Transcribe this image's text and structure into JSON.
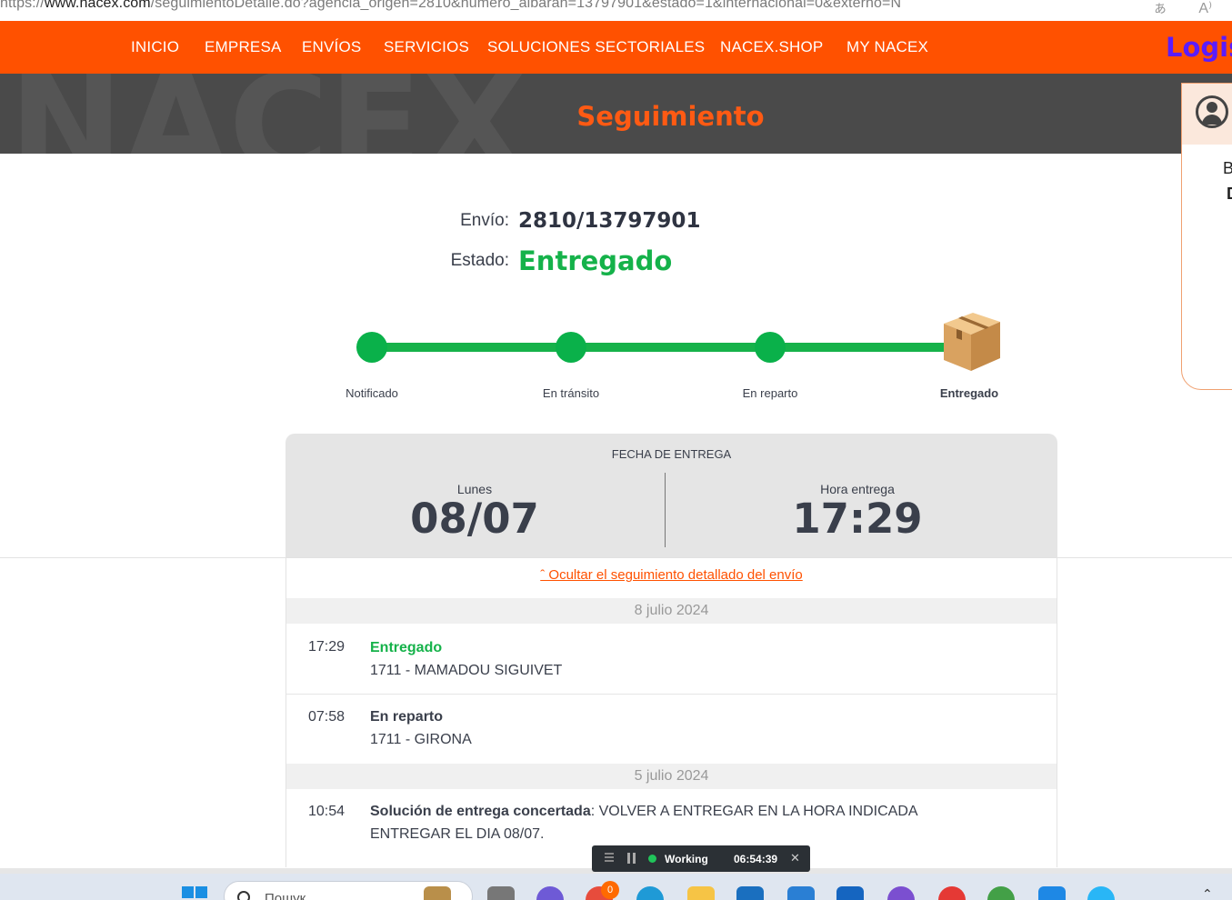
{
  "browser": {
    "url_prefix": "https://",
    "url_domain": "www.nacex.com",
    "url_path": "/seguimientoDetalle.do?agencia_origen=2810&numero_albaran=13797901&estado=1&internacional=0&externo=N",
    "icons": [
      "translate-icon",
      "read-aloud-icon"
    ],
    "icon_glyph_1": "ぁ",
    "icon_glyph_2": "A⁾"
  },
  "nav": {
    "items": [
      "INICIO",
      "EMPRESA",
      "ENVÍOS",
      "SERVICIOS",
      "SOLUCIONES SECTORIALES",
      "NACEX.SHOP",
      "MY NACEX"
    ],
    "logo": "Logis",
    "color": "#ff5100"
  },
  "hero": {
    "title": "Seguimiento"
  },
  "sidebox": {
    "line1": "B",
    "line2": "D"
  },
  "shipment": {
    "envio_label": "Envío:",
    "envio_value": "2810/13797901",
    "estado_label": "Estado:",
    "estado_value": "Entregado",
    "status_color": "#15b24a"
  },
  "progress": {
    "steps": [
      "Notificado",
      "En tránsito",
      "En reparto",
      "Entregado"
    ],
    "completed_steps": 4
  },
  "delivery": {
    "heading": "FECHA DE ENTREGA",
    "day_label": "Lunes",
    "date": "08/07",
    "time_label": "Hora entrega",
    "time": "17:29"
  },
  "detail": {
    "toggle_link": "ˆ Ocultar el seguimiento detallado del envío",
    "groups": [
      {
        "date": "8 julio 2024",
        "events": [
          {
            "time": "17:29",
            "title": "Entregado",
            "sub": "1711 - MAMADOU SIGUIVET"
          },
          {
            "time": "07:58",
            "title": "En reparto",
            "sub": "1711 - GIRONA"
          }
        ]
      },
      {
        "date": "5 julio 2024",
        "events": [
          {
            "time": "10:54",
            "title": "Solución de entrega concertada",
            "text": ": VOLVER A ENTREGAR EN LA HORA INDICADA",
            "sub": "ENTREGAR EL DIA 08/07."
          }
        ]
      }
    ]
  },
  "timer_widget": {
    "status": "Working",
    "elapsed": "06:54:39",
    "close": "✕"
  },
  "taskbar": {
    "search_placeholder": "Пошук",
    "badge": "0"
  }
}
